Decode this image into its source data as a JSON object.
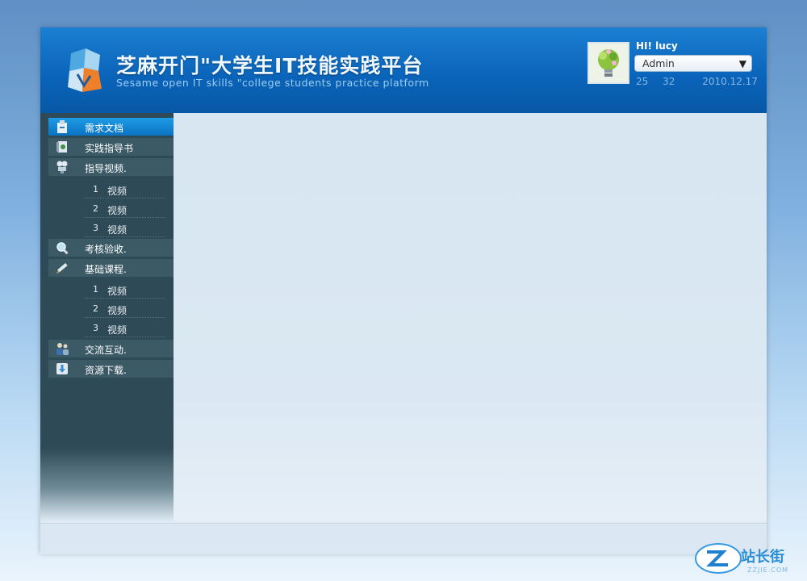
{
  "header": {
    "title_cn": "芝麻开门\"大学生IT技能实践平台",
    "title_en": "Sesame open IT skills \"college students practice platform"
  },
  "user": {
    "greeting": "HI!  lucy",
    "role": "Admin",
    "stat_1": "25",
    "stat_2": "32",
    "date": "2010.12.17"
  },
  "sidebar": {
    "items": [
      {
        "label": "需求文档",
        "icon": "document-icon",
        "active": true
      },
      {
        "label": "实践指导书",
        "icon": "book-icon"
      },
      {
        "label": "指导视频.",
        "icon": "video-camera-icon"
      },
      {
        "label": "考核验收.",
        "icon": "magnifier-icon"
      },
      {
        "label": "基础课程.",
        "icon": "pen-icon"
      },
      {
        "label": "交流互动.",
        "icon": "users-icon"
      },
      {
        "label": "资源下载.",
        "icon": "download-icon"
      }
    ],
    "video_sub": [
      {
        "num": "1",
        "label": "视频"
      },
      {
        "num": "2",
        "label": "视频"
      },
      {
        "num": "3",
        "label": "视频"
      }
    ],
    "course_sub": [
      {
        "num": "1",
        "label": "视频"
      },
      {
        "num": "2",
        "label": "视频"
      },
      {
        "num": "3",
        "label": "视频"
      }
    ]
  },
  "watermark": {
    "text": "站长街",
    "url": "ZZJIE.COM"
  }
}
